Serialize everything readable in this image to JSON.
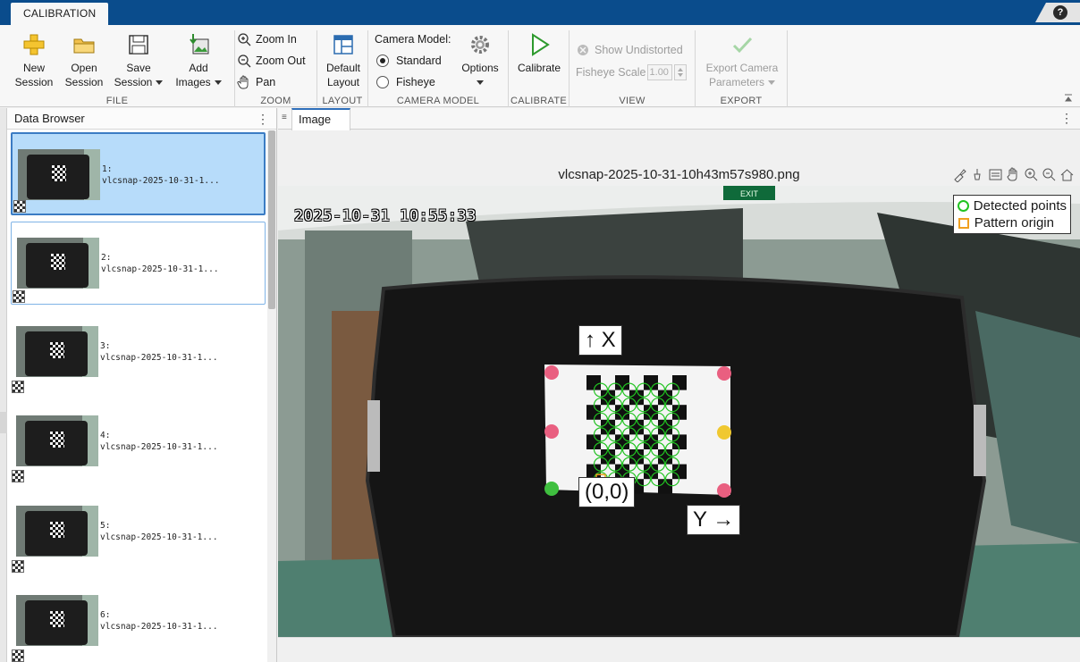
{
  "tabs": {
    "calibration": "CALIBRATION"
  },
  "help": "?",
  "ribbon": {
    "file": {
      "label": "FILE",
      "new_session": [
        "New",
        "Session"
      ],
      "open_session": [
        "Open",
        "Session"
      ],
      "save_session": [
        "Save",
        "Session"
      ],
      "add_images": [
        "Add",
        "Images"
      ]
    },
    "zoom": {
      "label": "ZOOM",
      "zoom_in": "Zoom In",
      "zoom_out": "Zoom Out",
      "pan": "Pan"
    },
    "layout": {
      "label": "LAYOUT",
      "default_layout": [
        "Default",
        "Layout"
      ]
    },
    "camera_model": {
      "label": "CAMERA MODEL",
      "title": "Camera Model:",
      "standard": "Standard",
      "fisheye": "Fisheye",
      "options": "Options",
      "selected": "Standard"
    },
    "calibrate": {
      "label": "CALIBRATE",
      "calibrate": "Calibrate"
    },
    "view": {
      "label": "VIEW",
      "show_undistorted": "Show Undistorted",
      "fisheye_scale_label": "Fisheye Scale",
      "fisheye_scale_value": "1.00"
    },
    "export": {
      "label": "EXPORT",
      "export_params": [
        "Export Camera",
        "Parameters"
      ]
    }
  },
  "data_browser": {
    "title": "Data Browser",
    "items": [
      {
        "num": "1:",
        "name": "vlcsnap-2025-10-31-1..."
      },
      {
        "num": "2:",
        "name": "vlcsnap-2025-10-31-1..."
      },
      {
        "num": "3:",
        "name": "vlcsnap-2025-10-31-1..."
      },
      {
        "num": "4:",
        "name": "vlcsnap-2025-10-31-1..."
      },
      {
        "num": "5:",
        "name": "vlcsnap-2025-10-31-1..."
      },
      {
        "num": "6:",
        "name": "vlcsnap-2025-10-31-1..."
      }
    ],
    "selected_index": 0
  },
  "image_panel": {
    "tab": "Image",
    "title": "vlcsnap-2025-10-31-10h43m57s980.png",
    "timestamp": "2025-10-31 10:55:33",
    "legend": {
      "detected": "Detected points",
      "origin": "Pattern origin"
    },
    "axis_x": "↑ X",
    "axis_y": "Y →",
    "origin": "(0,0)",
    "exit_sign": "EXIT",
    "colors": {
      "detected": "#22c322",
      "origin": "#f0a020"
    }
  }
}
